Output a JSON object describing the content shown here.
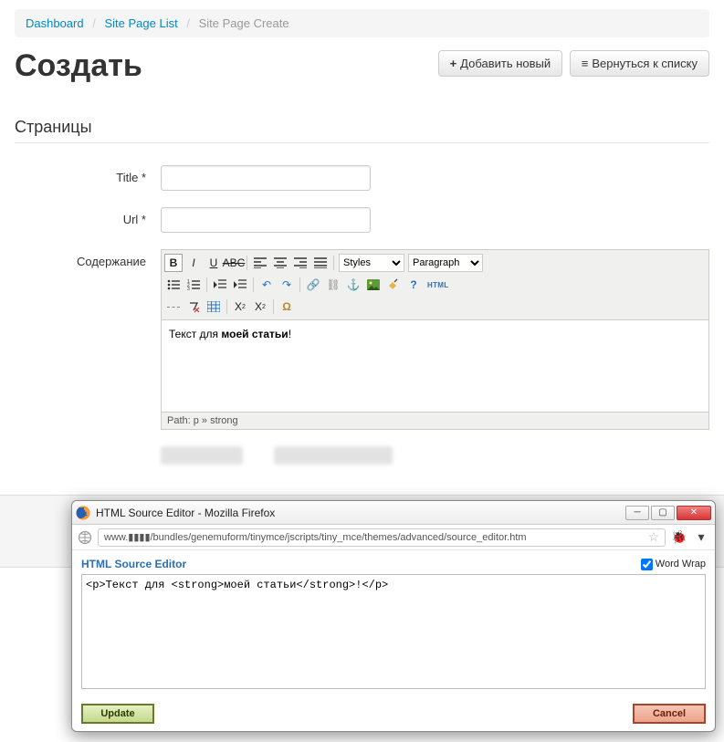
{
  "breadcrumb": {
    "items": [
      {
        "label": "Dashboard",
        "link": true
      },
      {
        "label": "Site Page List",
        "link": true
      },
      {
        "label": "Site Page Create",
        "link": false
      }
    ],
    "separator": "/"
  },
  "header": {
    "title": "Создать",
    "add_button": "Добавить новый",
    "back_button": "Вернуться к списку"
  },
  "section": {
    "title": "Страницы"
  },
  "form": {
    "title_label": "Title *",
    "title_value": "",
    "url_label": "Url *",
    "url_value": "",
    "content_label": "Содержание"
  },
  "editor": {
    "styles_select": "Styles",
    "format_select": "Paragraph",
    "content_prefix": "Текст для ",
    "content_bold": "моей статьи",
    "content_suffix": "!",
    "path": "Path: p » strong"
  },
  "popup": {
    "window_title": "HTML Source Editor - Mozilla Firefox",
    "url": "www.▮▮▮▮/bundles/genemuform/tinymce/jscripts/tiny_mce/themes/advanced/source_editor.htm",
    "src_title": "HTML Source Editor",
    "wrap_label": "Word Wrap",
    "wrap_checked": true,
    "source": "<p>Текст для <strong>моей статьи</strong>!</p>",
    "update": "Update",
    "cancel": "Cancel"
  }
}
